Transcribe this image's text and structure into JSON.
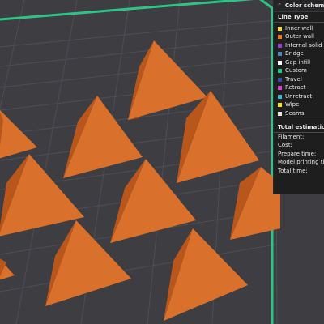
{
  "panel": {
    "header": "Color scheme",
    "line_type_title": "Line Type",
    "items": [
      {
        "label": "Inner wall",
        "color": "#f2d53a"
      },
      {
        "label": "Outer wall",
        "color": "#f07a1e"
      },
      {
        "label": "Internal solid infill",
        "color": "#9b3fd4"
      },
      {
        "label": "Bridge",
        "color": "#4a86b8"
      },
      {
        "label": "Gap infill",
        "color": "#ffffff"
      },
      {
        "label": "Custom",
        "color": "#1fc98c"
      },
      {
        "label": "Travel",
        "color": "#2d4fa8"
      },
      {
        "label": "Retract",
        "color": "#e23cd6"
      },
      {
        "label": "Unretract",
        "color": "#3fb8d8"
      },
      {
        "label": "Wipe",
        "color": "#f4e51c"
      },
      {
        "label": "Seams",
        "color": "#e6e6e6"
      }
    ],
    "estimation_title": "Total estimation",
    "estimation_rows": [
      {
        "label": "Filament:"
      },
      {
        "label": "Cost:"
      },
      {
        "label": "Prepare time:"
      },
      {
        "label": "Model printing time:"
      },
      {
        "label": "Total time:"
      }
    ]
  },
  "colors": {
    "bed": "#3d3d42",
    "grid": "#4e4e55",
    "bed_border": "#2fc487",
    "model_left": "#b8561b",
    "model_right": "#d9702b",
    "model_shadow": "#9e4615"
  }
}
